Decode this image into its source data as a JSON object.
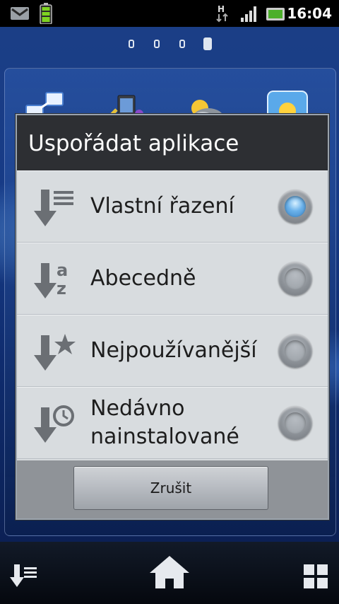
{
  "status_bar": {
    "time": "16:04",
    "network_type": "H"
  },
  "home": {
    "page_count": 4,
    "active_page": 4
  },
  "dialog": {
    "title": "Uspořádat aplikace",
    "options": [
      {
        "label": "Vlastní řazení",
        "icon": "sort-custom-icon",
        "selected": true
      },
      {
        "label": "Abecedně",
        "icon": "sort-alphabetical-icon",
        "selected": false
      },
      {
        "label": "Nejpoužívanější",
        "icon": "sort-most-used-icon",
        "selected": false
      },
      {
        "label": "Nedávno nainstalované",
        "icon": "sort-recent-icon",
        "selected": false
      }
    ],
    "cancel_label": "Zrušit"
  },
  "bottom_bar": {
    "left_icon": "sort-icon",
    "center_icon": "home-icon",
    "right_icon": "app-grid-icon"
  }
}
